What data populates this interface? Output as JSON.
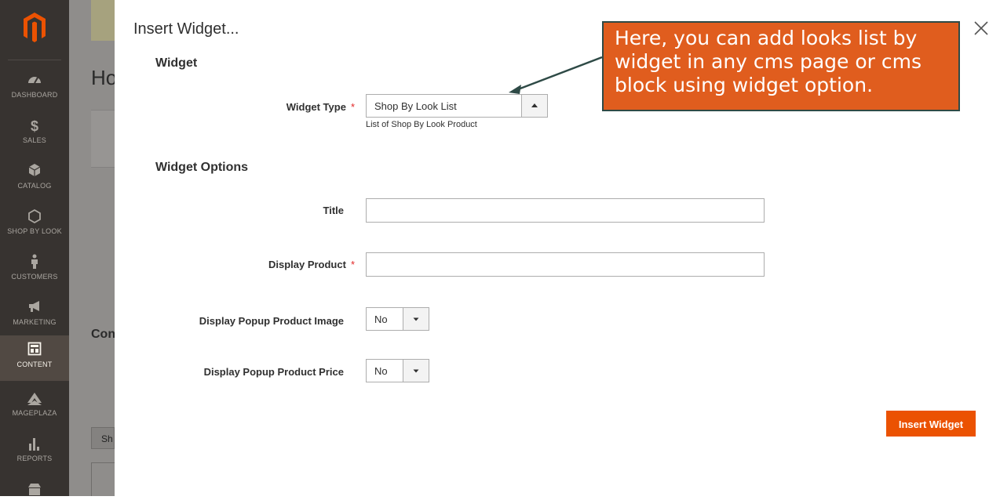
{
  "sidebar": {
    "items": [
      {
        "label": "DASHBOARD",
        "icon": "dashboard-icon"
      },
      {
        "label": "SALES",
        "icon": "dollar-icon"
      },
      {
        "label": "CATALOG",
        "icon": "box-icon"
      },
      {
        "label": "SHOP BY LOOK",
        "icon": "hexagon-icon"
      },
      {
        "label": "CUSTOMERS",
        "icon": "person-icon"
      },
      {
        "label": "MARKETING",
        "icon": "megaphone-icon"
      },
      {
        "label": "CONTENT",
        "icon": "layout-icon"
      },
      {
        "label": "MAGEPLAZA",
        "icon": "mageplaza-icon"
      },
      {
        "label": "REPORTS",
        "icon": "bar-chart-icon"
      }
    ]
  },
  "background_page": {
    "title": "Ho",
    "content_heading": "Con",
    "button_label": "Sh"
  },
  "modal": {
    "title": "Insert Widget...",
    "section_widget": "Widget",
    "widget_type_label": "Widget Type",
    "widget_type_value": "Shop By Look List",
    "widget_type_note": "List of Shop By Look Product",
    "section_options": "Widget Options",
    "title_label": "Title",
    "title_value": "",
    "display_product_label": "Display Product",
    "display_product_value": "",
    "popup_image_label": "Display Popup Product Image",
    "popup_image_value": "No",
    "popup_price_label": "Display Popup Product Price",
    "popup_price_value": "No",
    "required_mark": "*",
    "insert_button": "Insert Widget"
  },
  "callout": {
    "text": "Here, you can add looks list by widget in any cms page or cms block using widget option."
  },
  "colors": {
    "accent": "#eb5202",
    "callout": "#e05d1e",
    "sidebar": "#373330"
  }
}
